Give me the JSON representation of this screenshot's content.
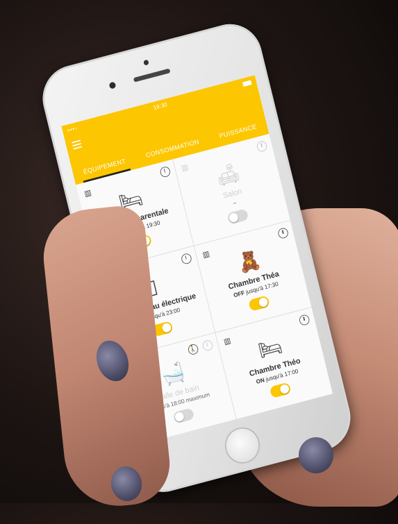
{
  "status": {
    "time": "16:30",
    "signal": "•••▫"
  },
  "tabs": [
    {
      "label": "ÉQUIPEMENT",
      "active": true
    },
    {
      "label": "CONSOMMATION",
      "active": false
    },
    {
      "label": "PUISSANCE",
      "active": false
    }
  ],
  "rooms": [
    {
      "name": "Chambre parentale",
      "state": "OFF",
      "until": "jusqu'à 19:30",
      "toggle_on": true,
      "icon": "bed-icon",
      "type_icon": "radiator-icon",
      "dim": false
    },
    {
      "name": "Salon",
      "state": "",
      "until": "–",
      "toggle_on": false,
      "icon": "sofa-icon",
      "type_icon": "radiator-icon",
      "dim": true
    },
    {
      "name": "Chauffe-eau électrique",
      "state": "ON",
      "until": "jusqu'à 23:00",
      "toggle_on": true,
      "icon": "water-heater-icon",
      "type_icon": "lightning-icon",
      "dim": false
    },
    {
      "name": "Chambre Théa",
      "state": "OFF",
      "until": "jusqu'à 17:30",
      "toggle_on": true,
      "icon": "toys-icon",
      "type_icon": "radiator-icon",
      "dim": false
    },
    {
      "name": "Salle de bain",
      "state": "",
      "until": "Jusqu'à 18:00 maximum",
      "toggle_on": false,
      "icon": "bathtub-icon",
      "type_icon": "radiator-icon",
      "dim": true
    },
    {
      "name": "Chambre Théo",
      "state": "ON",
      "until": "jusqu'à 17:00",
      "toggle_on": true,
      "icon": "bed-icon",
      "type_icon": "radiator-icon",
      "dim": false
    }
  ],
  "colors": {
    "accent": "#fcc600",
    "background": "#f0f0f0"
  }
}
